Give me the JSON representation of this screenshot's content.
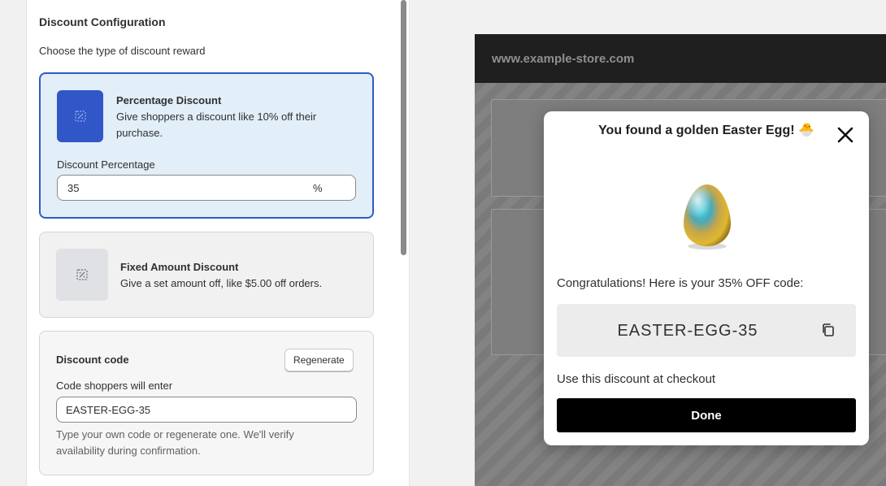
{
  "config": {
    "title": "Discount Configuration",
    "subtitle": "Choose the type of discount reward",
    "options": [
      {
        "title": "Percentage Discount",
        "description": "Give shoppers a discount like 10% off their purchase.",
        "icon": "discount-icon",
        "selected": true
      },
      {
        "title": "Fixed Amount Discount",
        "description": "Give a set amount off, like $5.00 off orders.",
        "icon": "discount-icon",
        "selected": false
      }
    ],
    "percentage": {
      "label": "Discount Percentage",
      "value": "35",
      "suffix": "%"
    },
    "discount_code": {
      "title": "Discount code",
      "regenerate_label": "Regenerate",
      "input_label": "Code shoppers will enter",
      "value": "EASTER-EGG-35",
      "help_text": "Type your own code or regenerate one. We'll verify availability during confirmation."
    }
  },
  "preview": {
    "store_url": "www.example-store.com",
    "modal": {
      "title": "You found a golden Easter Egg!",
      "title_emoji": "🐣",
      "congrats_text": "Congratulations! Here is your 35% OFF code:",
      "code": "EASTER-EGG-35",
      "use_text": "Use this discount at checkout",
      "done_label": "Done",
      "icons": {
        "close": "close-icon",
        "copy": "copy-icon",
        "egg": "golden-egg-image"
      }
    }
  },
  "colors": {
    "accent": "#2c5cc5",
    "selected_bg": "#e2eef8",
    "icon_bg": "#3056c7",
    "done_bg": "#000000"
  }
}
